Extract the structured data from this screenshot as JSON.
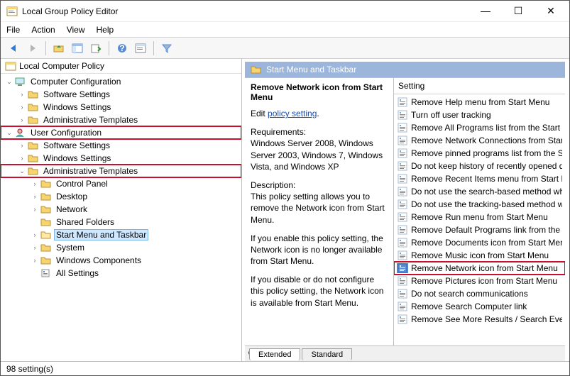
{
  "window": {
    "title": "Local Group Policy Editor"
  },
  "menus": [
    "File",
    "Action",
    "View",
    "Help"
  ],
  "tree_root": "Local Computer Policy",
  "tree": {
    "comp_config": "Computer Configuration",
    "cc_software": "Software Settings",
    "cc_windows": "Windows Settings",
    "cc_admin": "Administrative Templates",
    "user_config": "User Configuration",
    "uc_software": "Software Settings",
    "uc_windows": "Windows Settings",
    "uc_admin": "Administrative Templates",
    "control_panel": "Control Panel",
    "desktop": "Desktop",
    "network": "Network",
    "shared_folders": "Shared Folders",
    "startmenu": "Start Menu and Taskbar",
    "system": "System",
    "win_components": "Windows Components",
    "all_settings": "All Settings"
  },
  "details": {
    "header": "Start Menu and Taskbar",
    "title": "Remove Network icon from Start Menu",
    "edit_prefix": "Edit ",
    "edit_link": "policy setting",
    "req_label": "Requirements:",
    "req_text": "Windows Server 2008, Windows Server 2003, Windows 7, Windows Vista, and Windows XP",
    "desc_label": "Description:",
    "desc1": "This policy setting allows you to remove the Network icon from Start Menu.",
    "desc2": "If you enable this policy setting, the Network icon is no longer available from Start Menu.",
    "desc3": "If you disable or do not configure this policy setting, the Network icon is available from Start Menu."
  },
  "list_header": "Setting",
  "settings": [
    "Remove Help menu from Start Menu",
    "Turn off user tracking",
    "Remove All Programs list from the Start me",
    "Remove Network Connections from Start M",
    "Remove pinned programs list from the Start",
    "Do not keep history of recently opened doc",
    "Remove Recent Items menu from Start Men",
    "Do not use the search-based method when",
    "Do not use the tracking-based method whe",
    "Remove Run menu from Start Menu",
    "Remove Default Programs link from the Sta",
    "Remove Documents icon from Start Menu",
    "Remove Music icon from Start Menu",
    "Remove Network icon from Start Menu",
    "Remove Pictures icon from Start Menu",
    "Do not search communications",
    "Remove Search Computer link",
    "Remove See More Results / Search Everywh"
  ],
  "tabs": {
    "extended": "Extended",
    "standard": "Standard"
  },
  "status": "98 setting(s)"
}
